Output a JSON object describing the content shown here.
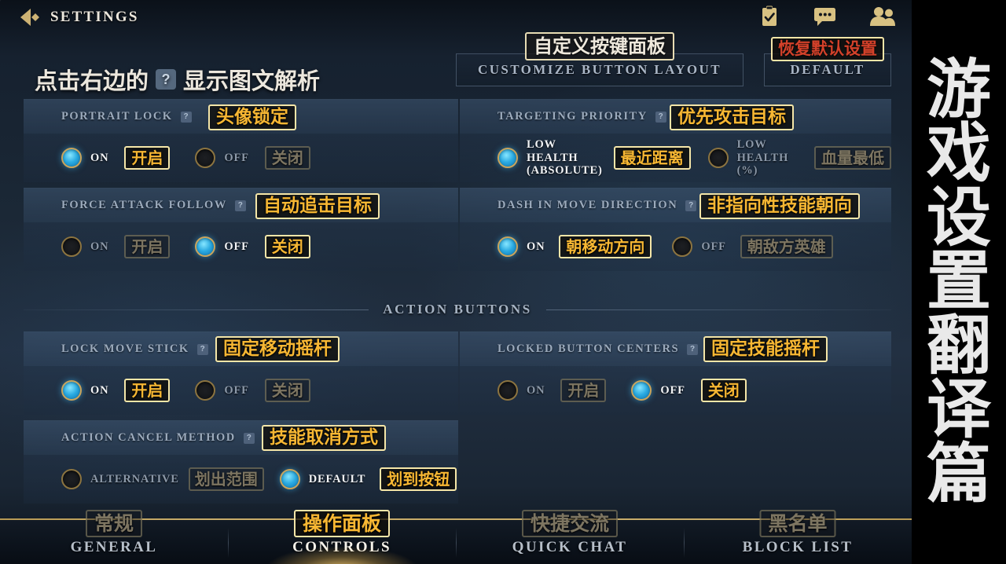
{
  "header": {
    "back_icon": "chevron-left-diamond-icon",
    "title": "SETTINGS",
    "icons": [
      {
        "name": "clipboard-check-icon"
      },
      {
        "name": "chat-bubble-icon"
      },
      {
        "name": "friends-icon"
      }
    ]
  },
  "instruction": {
    "text_before": "点击右边的",
    "help_glyph": "?",
    "text_after": "显示图文解析"
  },
  "top_buttons": {
    "customize": {
      "label": "CUSTOMIZE BUTTON LAYOUT",
      "badge": "自定义按键面板"
    },
    "default": {
      "label": "DEFAULT",
      "badge": "恢复默认设置"
    }
  },
  "settings": [
    {
      "id": "portrait-lock",
      "title": "PORTRAIT LOCK",
      "help": "?",
      "badge": "头像锁定",
      "options": [
        {
          "label": "ON",
          "badge": "开启",
          "selected": true
        },
        {
          "label": "OFF",
          "badge": "关闭",
          "selected": false
        }
      ]
    },
    {
      "id": "targeting-priority",
      "title": "TARGETING PRIORITY",
      "help": "?",
      "badge": "优先攻击目标",
      "options": [
        {
          "label": "LOW HEALTH\n(ABSOLUTE)",
          "badge": "最近距离",
          "selected": true
        },
        {
          "label": "LOW HEALTH\n(%)",
          "badge": "血量最低",
          "selected": false
        }
      ]
    },
    {
      "id": "force-attack-follow",
      "title": "FORCE ATTACK FOLLOW",
      "help": "?",
      "badge": "自动追击目标",
      "options": [
        {
          "label": "ON",
          "badge": "开启",
          "selected": false
        },
        {
          "label": "OFF",
          "badge": "关闭",
          "selected": true
        }
      ]
    },
    {
      "id": "dash-in-move-direction",
      "title": "DASH IN MOVE DIRECTION",
      "help": "?",
      "badge": "非指向性技能朝向",
      "options": [
        {
          "label": "ON",
          "badge": "朝移动方向",
          "selected": true
        },
        {
          "label": "OFF",
          "badge": "朝敌方英雄",
          "selected": false
        }
      ]
    },
    {
      "id": "lock-move-stick",
      "title": "LOCK MOVE STICK",
      "help": "?",
      "badge": "固定移动摇杆",
      "options": [
        {
          "label": "ON",
          "badge": "开启",
          "selected": true
        },
        {
          "label": "OFF",
          "badge": "关闭",
          "selected": false
        }
      ]
    },
    {
      "id": "locked-button-centers",
      "title": "LOCKED BUTTON CENTERS",
      "help": "?",
      "badge": "固定技能摇杆",
      "options": [
        {
          "label": "ON",
          "badge": "开启",
          "selected": false
        },
        {
          "label": "OFF",
          "badge": "关闭",
          "selected": true
        }
      ]
    },
    {
      "id": "action-cancel-method",
      "title": "ACTION CANCEL METHOD",
      "help": "?",
      "badge": "技能取消方式",
      "options": [
        {
          "label": "ALTERNATIVE",
          "badge": "划出范围",
          "selected": false
        },
        {
          "label": "DEFAULT",
          "badge": "划到按钮",
          "selected": true
        }
      ]
    }
  ],
  "section_action_buttons": "ACTION BUTTONS",
  "tabs": [
    {
      "label": "GENERAL",
      "badge": "常规",
      "active": false
    },
    {
      "label": "CONTROLS",
      "badge": "操作面板",
      "active": true
    },
    {
      "label": "QUICK CHAT",
      "badge": "快捷交流",
      "active": false
    },
    {
      "label": "BLOCK LIST",
      "badge": "黑名单",
      "active": false
    }
  ],
  "side_strip": {
    "chars": [
      "游",
      "戏",
      "设",
      "置",
      "翻",
      "译",
      "篇"
    ]
  },
  "colors": {
    "gold": "#c9ad6a",
    "badge_highlight": "#f7b733",
    "badge_dim": "#7d7561",
    "badge_red": "#d3412a",
    "radio_on": "#29a9e0",
    "panel_header": "#3e5672"
  }
}
